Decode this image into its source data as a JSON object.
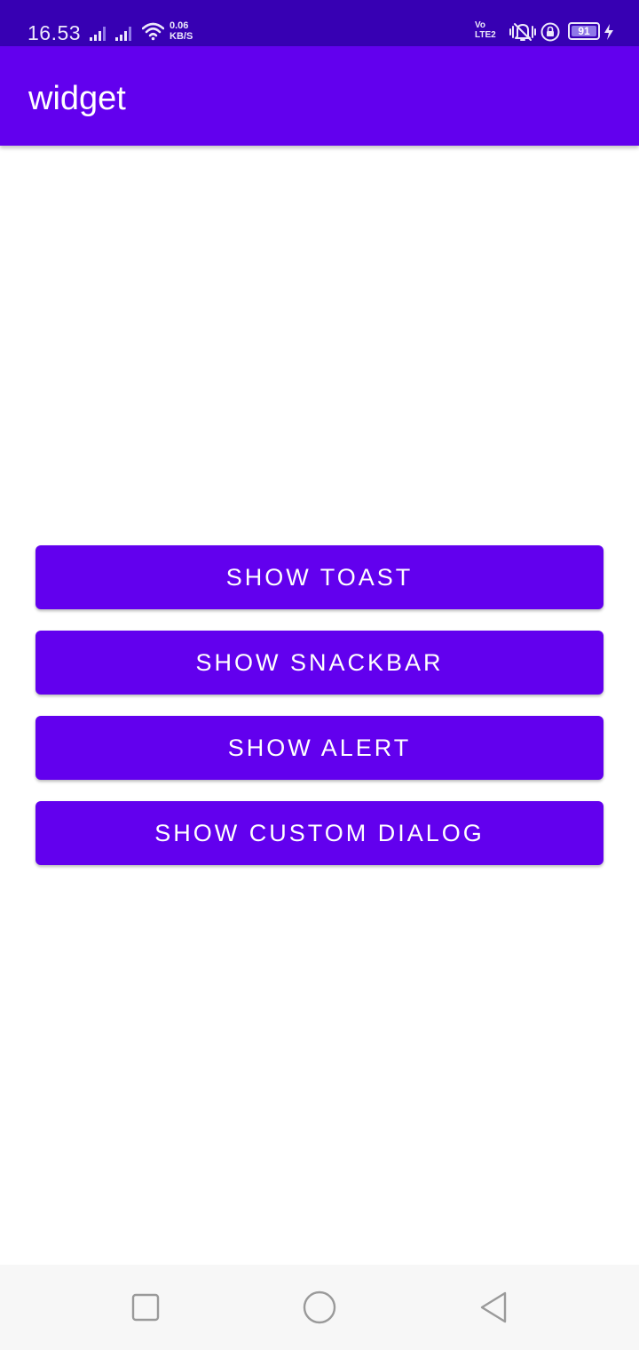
{
  "status_bar": {
    "time": "16.53",
    "net_speed_value": "0.06",
    "net_speed_unit": "KB/S",
    "volte_top": "Vo",
    "volte_bottom": "LTE2",
    "battery_level": "91",
    "icons": [
      "signal-icon",
      "signal-icon",
      "wifi-icon",
      "vibrate-icon",
      "rotation-lock-icon",
      "battery-icon",
      "charging-icon"
    ]
  },
  "app_bar": {
    "title": "widget"
  },
  "buttons": {
    "show_toast": "Show Toast",
    "show_snackbar": "Show Snackbar",
    "show_alert": "Show Alert",
    "show_custom_dialog": "Show Custom Dialog"
  },
  "nav_bar": {
    "icons": [
      "recent-apps-icon",
      "home-icon",
      "back-icon"
    ]
  },
  "colors": {
    "status_bar": "#3700b3",
    "primary": "#6200ee",
    "nav_bar": "#f7f7f7",
    "background": "#ffffff"
  }
}
